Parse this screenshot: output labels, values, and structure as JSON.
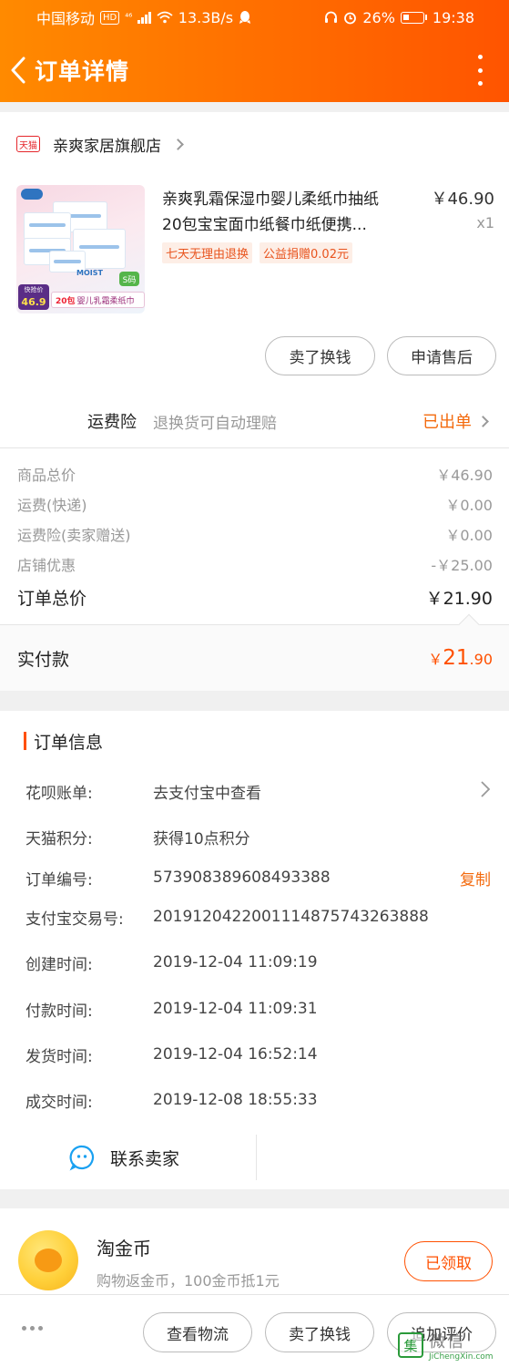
{
  "status_bar": {
    "carrier": "中国移动",
    "hd": "HD",
    "net": "⁴⁶",
    "speed": "13.3B/s",
    "battery": "26%",
    "time": "19:38"
  },
  "header": {
    "title": "订单详情"
  },
  "shop": {
    "badge": "天猫",
    "name": "亲爽家居旗舰店"
  },
  "product": {
    "title_line1": "亲爽乳霜保湿巾婴儿柔纸巾抽纸",
    "title_line2": "20包宝宝面巾纸餐巾纸便携...",
    "price": "￥46.90",
    "qty": "x1",
    "tags": [
      "七天无理由退换",
      "公益捐赠0.02元"
    ],
    "image": {
      "price_label": "快抢价",
      "price_value": "46.9",
      "caption_bold": "20包",
      "caption": "婴儿乳霜柔纸巾",
      "size_badge": "S码",
      "brand": "MOIST"
    }
  },
  "actions": {
    "swap": "卖了换钱",
    "after_sale": "申请售后"
  },
  "shipping_insurance": {
    "label": "运费险",
    "desc": "退换货可自动理赔",
    "status": "已出单"
  },
  "fees": [
    {
      "label": "商品总价",
      "value": "￥46.90"
    },
    {
      "label": "运费(快递)",
      "value": "￥0.00"
    },
    {
      "label": "运费险(卖家赠送)",
      "value": "￥0.00"
    },
    {
      "label": "店铺优惠",
      "value": "-￥25.00"
    }
  ],
  "order_total": {
    "label": "订单总价",
    "value": "￥21.90"
  },
  "paid": {
    "label": "实付款",
    "symbol": "￥",
    "int": "21",
    "dec": ".90"
  },
  "order_info": {
    "title": "订单信息",
    "rows": [
      {
        "label": "花呗账单:",
        "value": "去支付宝中查看"
      },
      {
        "label": "天猫积分:",
        "value": "获得10点积分"
      },
      {
        "label": "订单编号:",
        "value": "573908389608493388",
        "action": "复制"
      },
      {
        "label": "支付宝交易号:",
        "value": "2019120422001114875743263888"
      },
      {
        "label": "创建时间:",
        "value": "2019-12-04 11:09:19"
      },
      {
        "label": "付款时间:",
        "value": "2019-12-04 11:09:31"
      },
      {
        "label": "发货时间:",
        "value": "2019-12-04 16:52:14"
      },
      {
        "label": "成交时间:",
        "value": "2019-12-08 18:55:33"
      }
    ],
    "contact": "联系卖家"
  },
  "coin": {
    "name": "淘金币",
    "desc": "购物返金币，100金币抵1元",
    "button": "已领取"
  },
  "bottom_bar": {
    "logistics": "查看物流",
    "swap": "卖了换钱",
    "review": "追加评价"
  },
  "watermark": {
    "logo": "集",
    "text": "微信",
    "url": "JiChengXin.com"
  },
  "colors": {
    "accent": "#ff5000",
    "header": "#ff7a00"
  }
}
